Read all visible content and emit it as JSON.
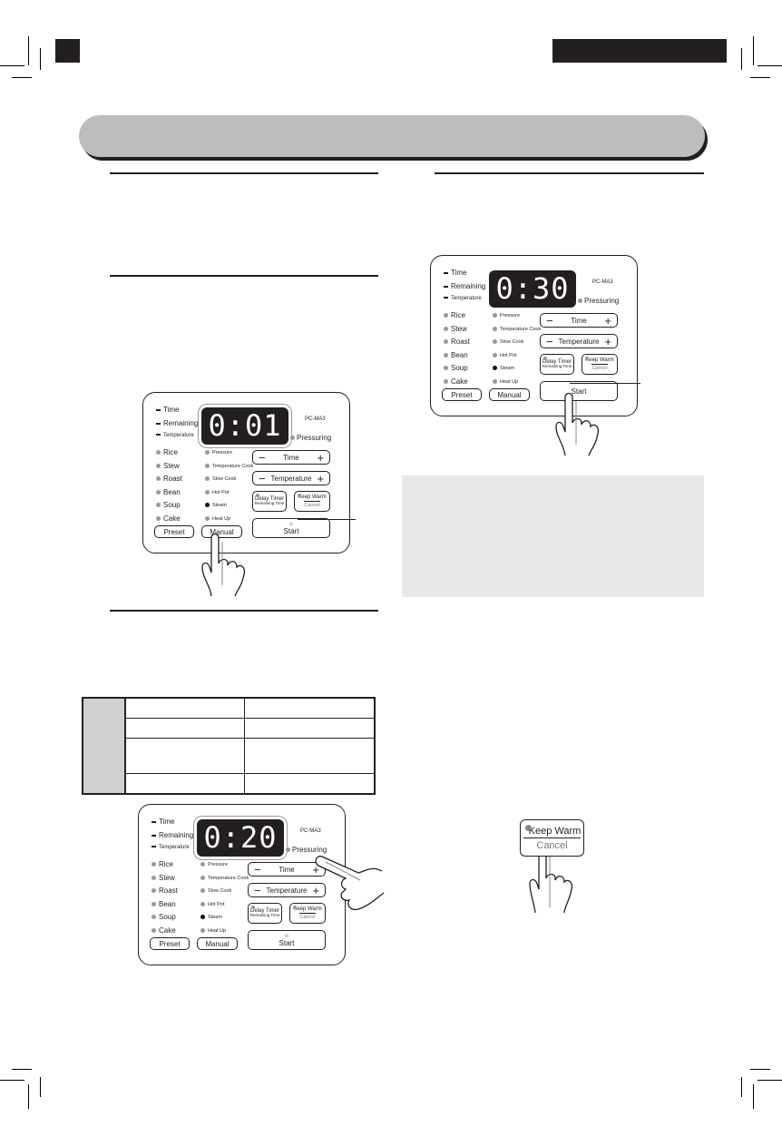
{
  "page": {
    "header_bar_text": "",
    "tab_left_text": "",
    "tab_right_text": ""
  },
  "panels": [
    {
      "id": "panel-manual",
      "display": "0:01",
      "display_blinking": true,
      "model": "PC-MA3",
      "pressuring_label": "Pressuring",
      "indicators": [
        "Time",
        "Remaining",
        "Temperature"
      ],
      "menu_left": [
        "Rice",
        "Stew",
        "Roast",
        "Bean",
        "Soup",
        "Cake"
      ],
      "menu_right": [
        "Pressure",
        "Temperature Cook",
        "Slow Cook",
        "Hot Pot",
        "Steam",
        "Heat Up"
      ],
      "active_menu": "Steam",
      "time_label": "Time",
      "temperature_label": "Temperature",
      "minus": "−",
      "plus": "+",
      "delay_timer_label": "Delay Timer",
      "remaining_time_label": "Remaining Time",
      "keep_warm_label": "Keep Warm",
      "cancel_label": "Cancel",
      "start_label": "Start",
      "preset_label": "Preset",
      "manual_label": "Manual",
      "pressed": "Manual",
      "start_blinking": true
    },
    {
      "id": "panel-start",
      "display": "0:30",
      "display_blinking": false,
      "model": "PC-MA3",
      "pressuring_label": "Pressuring",
      "indicators": [
        "Time",
        "Remaining",
        "Temperature"
      ],
      "menu_left": [
        "Rice",
        "Stew",
        "Roast",
        "Bean",
        "Soup",
        "Cake"
      ],
      "menu_right": [
        "Pressure",
        "Temperature Cook",
        "Slow Cook",
        "Hot Pot",
        "Steam",
        "Heat Up"
      ],
      "active_menu": "Steam",
      "time_label": "Time",
      "temperature_label": "Temperature",
      "minus": "−",
      "plus": "+",
      "delay_timer_label": "Delay Timer",
      "remaining_time_label": "Remaining Time",
      "keep_warm_label": "Keep Warm",
      "cancel_label": "Cancel",
      "start_label": "Start",
      "preset_label": "Preset",
      "manual_label": "Manual",
      "pressed": "Start",
      "start_blinking": false
    },
    {
      "id": "panel-time-adjust",
      "display": "0:20",
      "display_blinking": true,
      "model": "PC-MA3",
      "pressuring_label": "Pressuring",
      "indicators": [
        "Time",
        "Remaining",
        "Temperature"
      ],
      "menu_left": [
        "Rice",
        "Stew",
        "Roast",
        "Bean",
        "Soup",
        "Cake"
      ],
      "menu_right": [
        "Pressure",
        "Temperature Cook",
        "Slow Cook",
        "Hot Pot",
        "Steam",
        "Heat Up"
      ],
      "active_menu": "Steam",
      "time_label": "Time",
      "temperature_label": "Temperature",
      "minus": "−",
      "plus": "+",
      "delay_timer_label": "Delay Timer",
      "remaining_time_label": "Remaining Time",
      "keep_warm_label": "Keep Warm",
      "cancel_label": "Cancel",
      "start_label": "Start",
      "preset_label": "Preset",
      "manual_label": "Manual",
      "pressed": "Time +",
      "start_blinking": true
    }
  ],
  "keep_warm_closeup": {
    "keep_warm_label": "Keep Warm",
    "cancel_label": "Cancel"
  },
  "spec_table": {
    "rows": [
      [
        "",
        ""
      ],
      [
        "",
        ""
      ],
      [
        "",
        ""
      ],
      [
        "",
        ""
      ]
    ]
  },
  "colors": {
    "ink": "#231f20",
    "header_bar": "#bdbdbd",
    "note_box": "#e8e8e8",
    "table_side": "#d0d0d0",
    "led_off": "#999999"
  }
}
